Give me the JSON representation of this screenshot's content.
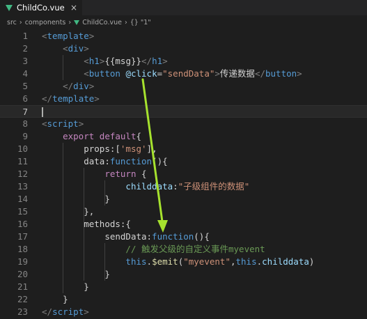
{
  "tab": {
    "title": "ChildCo.vue",
    "close_glyph": "×"
  },
  "breadcrumb": [
    "src",
    "components",
    "ChildCo.vue",
    "{} \"1\""
  ],
  "lines": [
    {
      "n": "1",
      "tokens": [
        {
          "t": "<",
          "c": "t-punc"
        },
        {
          "t": "template",
          "c": "t-tag"
        },
        {
          "t": ">",
          "c": "t-punc"
        }
      ]
    },
    {
      "n": "2",
      "tokens": [
        {
          "t": "    "
        },
        {
          "t": "<",
          "c": "t-punc"
        },
        {
          "t": "div",
          "c": "t-tag"
        },
        {
          "t": ">",
          "c": "t-punc"
        }
      ]
    },
    {
      "n": "3",
      "tokens": [
        {
          "t": "        "
        },
        {
          "t": "<",
          "c": "t-punc"
        },
        {
          "t": "h1",
          "c": "t-tag"
        },
        {
          "t": ">",
          "c": "t-punc"
        },
        {
          "t": "{{msg}}",
          "c": "t-txt"
        },
        {
          "t": "</",
          "c": "t-punc"
        },
        {
          "t": "h1",
          "c": "t-tag"
        },
        {
          "t": ">",
          "c": "t-punc"
        }
      ]
    },
    {
      "n": "4",
      "tokens": [
        {
          "t": "        "
        },
        {
          "t": "<",
          "c": "t-punc"
        },
        {
          "t": "button",
          "c": "t-tag"
        },
        {
          "t": " "
        },
        {
          "t": "@click",
          "c": "t-attr"
        },
        {
          "t": "=",
          "c": "t-txt"
        },
        {
          "t": "\"sendData\"",
          "c": "t-str"
        },
        {
          "t": ">",
          "c": "t-punc"
        },
        {
          "t": "传递数据",
          "c": "t-txt"
        },
        {
          "t": "</",
          "c": "t-punc"
        },
        {
          "t": "button",
          "c": "t-tag"
        },
        {
          "t": ">",
          "c": "t-punc"
        }
      ]
    },
    {
      "n": "5",
      "tokens": [
        {
          "t": "    "
        },
        {
          "t": "</",
          "c": "t-punc"
        },
        {
          "t": "div",
          "c": "t-tag"
        },
        {
          "t": ">",
          "c": "t-punc"
        }
      ]
    },
    {
      "n": "6",
      "tokens": [
        {
          "t": "</",
          "c": "t-punc"
        },
        {
          "t": "template",
          "c": "t-tag"
        },
        {
          "t": ">",
          "c": "t-punc"
        }
      ]
    },
    {
      "n": "7",
      "tokens": [],
      "current": true
    },
    {
      "n": "8",
      "tokens": [
        {
          "t": "<",
          "c": "t-punc"
        },
        {
          "t": "script",
          "c": "t-tag"
        },
        {
          "t": ">",
          "c": "t-punc"
        }
      ]
    },
    {
      "n": "9",
      "tokens": [
        {
          "t": "    "
        },
        {
          "t": "export",
          "c": "t-kw"
        },
        {
          "t": " "
        },
        {
          "t": "default",
          "c": "t-kw"
        },
        {
          "t": "{",
          "c": "t-txt"
        }
      ]
    },
    {
      "n": "10",
      "tokens": [
        {
          "t": "        "
        },
        {
          "t": "props:[",
          "c": "t-txt"
        },
        {
          "t": "'msg'",
          "c": "t-str"
        },
        {
          "t": "],",
          "c": "t-txt"
        }
      ]
    },
    {
      "n": "11",
      "tokens": [
        {
          "t": "        "
        },
        {
          "t": "data:",
          "c": "t-txt"
        },
        {
          "t": "function",
          "c": "t-blue"
        },
        {
          "t": "(){",
          "c": "t-txt"
        }
      ]
    },
    {
      "n": "12",
      "tokens": [
        {
          "t": "            "
        },
        {
          "t": "return",
          "c": "t-kw"
        },
        {
          "t": " {",
          "c": "t-txt"
        }
      ]
    },
    {
      "n": "13",
      "tokens": [
        {
          "t": "                "
        },
        {
          "t": "childdata",
          "c": "t-var"
        },
        {
          "t": ":",
          "c": "t-txt"
        },
        {
          "t": "\"子级组件的数据\"",
          "c": "t-str"
        }
      ]
    },
    {
      "n": "14",
      "tokens": [
        {
          "t": "            "
        },
        {
          "t": "}",
          "c": "t-txt"
        }
      ]
    },
    {
      "n": "15",
      "tokens": [
        {
          "t": "        "
        },
        {
          "t": "},",
          "c": "t-txt"
        }
      ]
    },
    {
      "n": "16",
      "tokens": [
        {
          "t": "        "
        },
        {
          "t": "methods:{",
          "c": "t-txt"
        }
      ]
    },
    {
      "n": "17",
      "tokens": [
        {
          "t": "            "
        },
        {
          "t": "sendData:",
          "c": "t-txt"
        },
        {
          "t": "function",
          "c": "t-blue"
        },
        {
          "t": "(){",
          "c": "t-txt"
        }
      ]
    },
    {
      "n": "18",
      "tokens": [
        {
          "t": "                "
        },
        {
          "t": "// 触发父级的自定义事件myevent",
          "c": "t-cm"
        }
      ]
    },
    {
      "n": "19",
      "tokens": [
        {
          "t": "                "
        },
        {
          "t": "this",
          "c": "t-blue"
        },
        {
          "t": ".",
          "c": "t-txt"
        },
        {
          "t": "$emit",
          "c": "t-fn"
        },
        {
          "t": "(",
          "c": "t-txt"
        },
        {
          "t": "\"myevent\"",
          "c": "t-str"
        },
        {
          "t": ",",
          "c": "t-txt"
        },
        {
          "t": "this",
          "c": "t-blue"
        },
        {
          "t": ".",
          "c": "t-txt"
        },
        {
          "t": "childdata",
          "c": "t-var"
        },
        {
          "t": ")",
          "c": "t-txt"
        }
      ]
    },
    {
      "n": "20",
      "tokens": [
        {
          "t": "            "
        },
        {
          "t": "}",
          "c": "t-txt"
        }
      ]
    },
    {
      "n": "21",
      "tokens": [
        {
          "t": "        "
        },
        {
          "t": "}",
          "c": "t-txt"
        }
      ]
    },
    {
      "n": "22",
      "tokens": [
        {
          "t": "    "
        },
        {
          "t": "}",
          "c": "t-txt"
        }
      ]
    },
    {
      "n": "23",
      "tokens": [
        {
          "t": "</",
          "c": "t-punc"
        },
        {
          "t": "script",
          "c": "t-tag"
        },
        {
          "t": ">",
          "c": "t-punc"
        }
      ]
    }
  ],
  "annotation": {
    "arrow_color": "#a6e22e"
  }
}
